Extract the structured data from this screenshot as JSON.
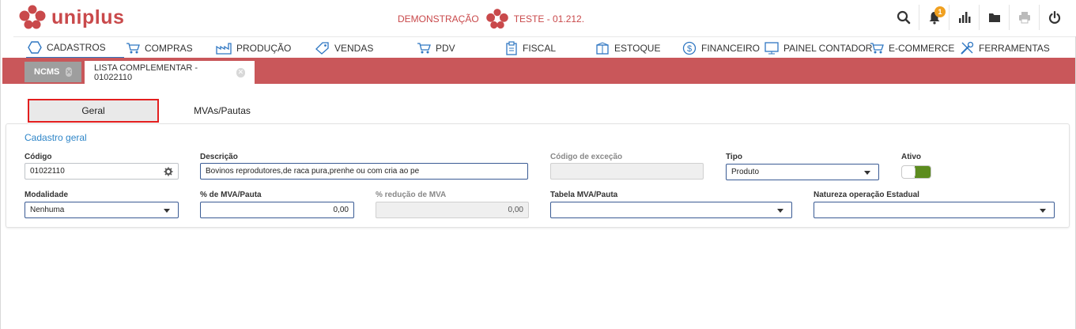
{
  "app": {
    "name": "uniplus"
  },
  "header": {
    "mode": "DEMONSTRAÇÃO",
    "company": "TESTE - 01.212.",
    "notification_count": "1",
    "icons": [
      "search-icon",
      "bell-icon",
      "chart-icon",
      "folder-icon",
      "printer-icon",
      "power-icon"
    ]
  },
  "menu": {
    "items": [
      {
        "label": "CADASTROS",
        "icon": "hexagon-icon"
      },
      {
        "label": "COMPRAS",
        "icon": "cart-icon"
      },
      {
        "label": "PRODUÇÃO",
        "icon": "factory-icon"
      },
      {
        "label": "VENDAS",
        "icon": "tag-icon"
      },
      {
        "label": "PDV",
        "icon": "cart-icon"
      },
      {
        "label": "FISCAL",
        "icon": "clipboard-icon"
      },
      {
        "label": "ESTOQUE",
        "icon": "box-icon"
      },
      {
        "label": "FINANCEIRO",
        "icon": "dollar-icon"
      },
      {
        "label": "PAINEL CONTADOR",
        "icon": "monitor-icon"
      },
      {
        "label": "E-COMMERCE",
        "icon": "cart-icon"
      },
      {
        "label": "FERRAMENTAS",
        "icon": "tools-icon"
      }
    ]
  },
  "tabs": [
    {
      "label": "NCMS"
    },
    {
      "label": "LISTA COMPLEMENTAR - 01022110"
    }
  ],
  "subtabs": [
    {
      "label": "Geral"
    },
    {
      "label": "MVAs/Pautas"
    }
  ],
  "form": {
    "section_title": "Cadastro geral",
    "codigo": {
      "label": "Código",
      "value": "01022110"
    },
    "descricao": {
      "label": "Descrição",
      "value": "Bovinos reprodutores,de raca pura,prenhe ou com cria ao pe"
    },
    "codigo_excecao": {
      "label": "Código de exceção",
      "value": ""
    },
    "tipo": {
      "label": "Tipo",
      "value": "Produto"
    },
    "ativo": {
      "label": "Ativo",
      "value": true
    },
    "modalidade": {
      "label": "Modalidade",
      "value": "Nenhuma"
    },
    "mva_pauta": {
      "label": "% de MVA/Pauta",
      "value": "0,00"
    },
    "reducao_mva": {
      "label": "% redução de MVA",
      "value": "0,00"
    },
    "tabela_mva": {
      "label": "Tabela MVA/Pauta",
      "value": ""
    },
    "natureza": {
      "label": "Natureza operação Estadual",
      "value": ""
    }
  },
  "colors": {
    "brand": "#c9494b",
    "tabbar": "#c9575a",
    "accent": "#2f86c8",
    "toggle_on": "#5c8c1e"
  }
}
